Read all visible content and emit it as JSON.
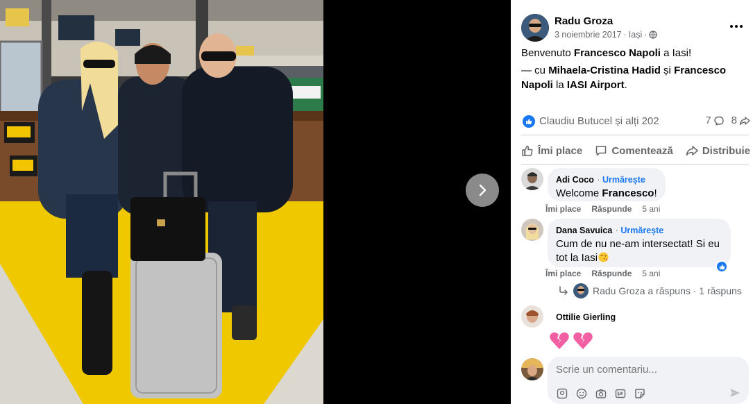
{
  "post": {
    "author": "Radu Groza",
    "date": "3 noiembrie 2017",
    "location": "Iași",
    "text_line1_prefix": "Benvenuto ",
    "text_line1_name": "Francesco Napoli",
    "text_line1_suffix": " a Iasi!",
    "text_line2_prefix": "— cu ",
    "text_line2_name1": "Mihaela-Cristina Hadid",
    "text_line2_mid": " și ",
    "text_line2_name2": "Francesco Napoli",
    "text_line2_at": " la ",
    "text_line2_place": "IASI Airport",
    "text_line2_end": "."
  },
  "reactions": {
    "summary": "Claudiu Butucel și alți 202",
    "comments_count": "7",
    "shares_count": "8"
  },
  "actions": {
    "like": "Îmi place",
    "comment": "Comentează",
    "share": "Distribuie"
  },
  "comments": [
    {
      "name": "Adi Coco",
      "follow": "Urmărește",
      "text_prefix": "Welcome ",
      "text_bold": "Francesco",
      "text_suffix": "!",
      "like": "Îmi place",
      "reply": "Răspunde",
      "time": "5 ani"
    },
    {
      "name": "Dana Savuica",
      "follow": "Urmărește",
      "text": "Cum de nu ne-am intersectat! Si eu tot la Iasi",
      "like": "Îmi place",
      "reply": "Răspunde",
      "time": "5 ani",
      "replies_text": "Radu Groza a răspuns · 1 răspuns"
    },
    {
      "name": "Ottilie Gierling"
    }
  ],
  "compose": {
    "placeholder": "Scrie un comentariu..."
  },
  "colors": {
    "accent": "#1877f2",
    "muted": "#65676b",
    "bubble": "#f0f2f5"
  }
}
